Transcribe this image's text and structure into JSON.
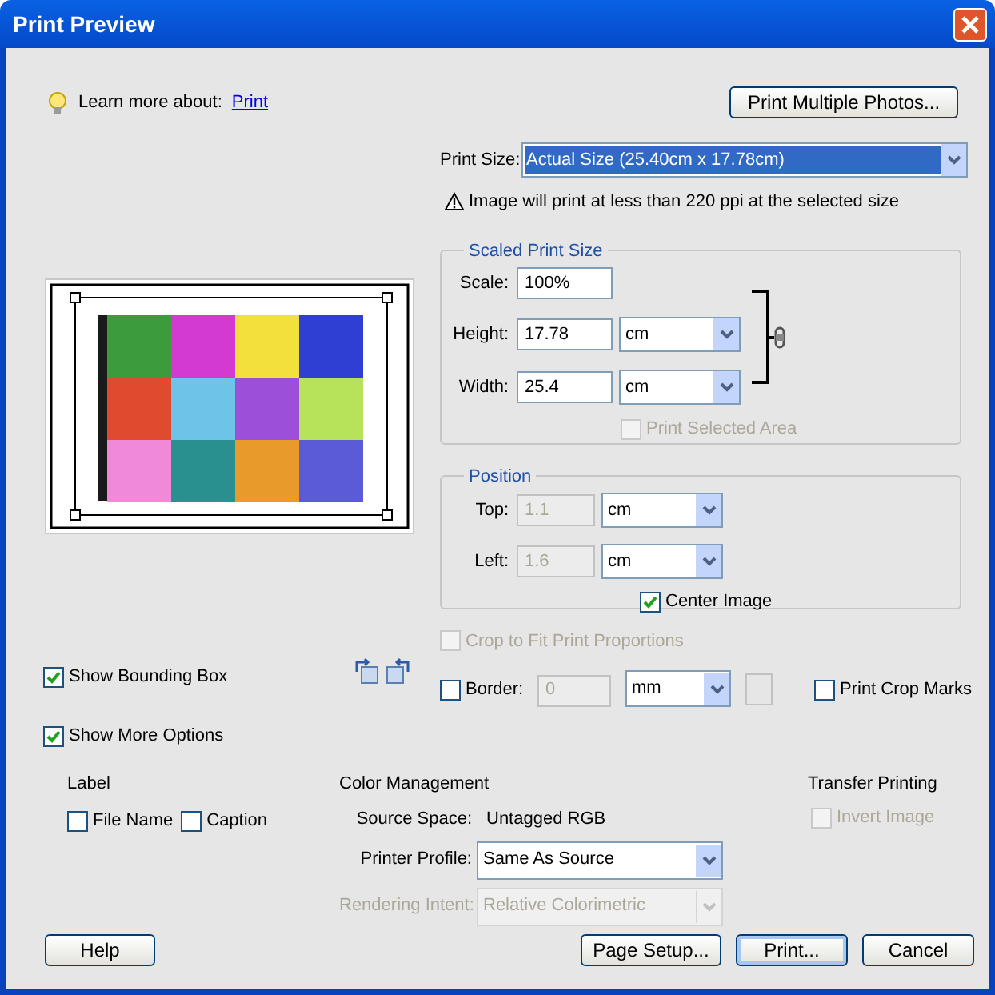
{
  "window": {
    "title": "Print Preview"
  },
  "help_hint": {
    "label": "Learn more about:",
    "link": "Print"
  },
  "print_multiple_button": "Print Multiple Photos...",
  "print_size": {
    "label": "Print Size:",
    "value": "Actual Size (25.40cm x 17.78cm)"
  },
  "warning": "Image will print at less than 220 ppi at the selected size",
  "scaled_print_size": {
    "title": "Scaled Print Size",
    "scale": {
      "label": "Scale:",
      "value": "100%"
    },
    "height": {
      "label": "Height:",
      "value": "17.78",
      "unit": "cm"
    },
    "width": {
      "label": "Width:",
      "value": "25.4",
      "unit": "cm"
    },
    "print_selected_area": {
      "label": "Print Selected Area",
      "checked": false,
      "disabled": true
    }
  },
  "position": {
    "title": "Position",
    "top": {
      "label": "Top:",
      "value": "1.1",
      "unit": "cm",
      "disabled": true
    },
    "left": {
      "label": "Left:",
      "value": "1.6",
      "unit": "cm",
      "disabled": true
    },
    "center_image": {
      "label": "Center Image",
      "checked": true,
      "disabled": false
    }
  },
  "crop_to_fit": {
    "label": "Crop to Fit Print Proportions",
    "checked": false,
    "disabled": true
  },
  "show_bounding_box": {
    "label": "Show Bounding Box",
    "checked": true,
    "disabled": false
  },
  "border": {
    "label": "Border:",
    "checked": false,
    "disabled": false,
    "value": "0",
    "value_disabled": true,
    "unit": "mm"
  },
  "print_crop_marks": {
    "label": "Print Crop Marks",
    "checked": false,
    "disabled": false
  },
  "show_more_options": {
    "label": "Show More Options",
    "checked": true,
    "disabled": false
  },
  "label_section": {
    "title": "Label",
    "options": [
      {
        "label": "File Name",
        "checked": false,
        "disabled": false
      },
      {
        "label": "Caption",
        "checked": false,
        "disabled": false
      }
    ]
  },
  "color_management": {
    "title": "Color Management",
    "source_space": {
      "label": "Source Space:",
      "value": "Untagged RGB"
    },
    "printer_profile": {
      "label": "Printer Profile:",
      "value": "Same As Source",
      "disabled": false
    },
    "rendering_intent": {
      "label": "Rendering Intent:",
      "value": "Relative Colorimetric",
      "disabled": true
    }
  },
  "transfer_printing": {
    "title": "Transfer Printing",
    "invert_image": {
      "label": "Invert Image",
      "checked": false,
      "disabled": true
    }
  },
  "buttons": [
    {
      "label": "Help",
      "default": false
    },
    {
      "label": "Page Setup...",
      "default": false
    },
    {
      "label": "Print...",
      "default": true
    },
    {
      "label": "Cancel",
      "default": false
    }
  ]
}
